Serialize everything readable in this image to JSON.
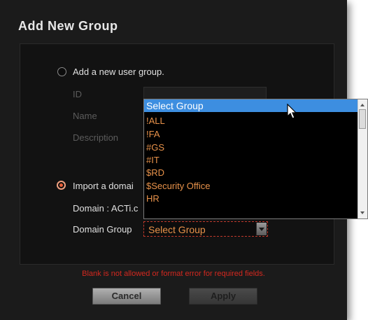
{
  "dialog": {
    "title": "Add New Group",
    "option_new": {
      "label": "Add a new user group.",
      "id_label": "ID",
      "name_label": "Name",
      "description_label": "Description"
    },
    "option_import": {
      "label": "Import a domai",
      "domain_label": "Domain : ACTi.c",
      "domain_group_label": "Domain Group",
      "domain_group_value": "Select Group"
    },
    "error": "Blank is not allowed or format error for required fields.",
    "cancel_label": "Cancel",
    "apply_label": "Apply"
  },
  "dropdown": {
    "selected": "Select Group",
    "options": [
      "!ALL",
      "!FA",
      "#GS",
      "#IT",
      "$RD",
      "$Security Office",
      "HR"
    ]
  },
  "colors": {
    "accent_orange": "#e8924a",
    "selection_blue": "#3d8ee0",
    "error_red": "#d4281f"
  }
}
